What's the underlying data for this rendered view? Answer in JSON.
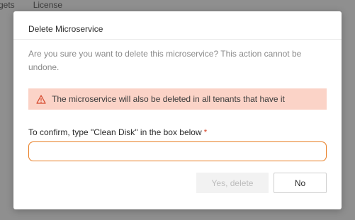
{
  "background": {
    "tabs": [
      "rgets",
      "License"
    ]
  },
  "dialog": {
    "title": "Delete Microservice",
    "message": "Are you sure you want to delete this microservice? This action cannot be undone.",
    "warning": {
      "icon": "warning-triangle-icon",
      "text": "The microservice will also be deleted in all tenants that have it"
    },
    "confirm_label": "To confirm, type \"Clean Disk\" in the box below",
    "required_marker": "*",
    "input_value": "",
    "yes_label": "Yes, delete",
    "no_label": "No"
  },
  "colors": {
    "accent": "#e87d22",
    "warning_bg": "#fbd3c7",
    "warning_icon": "#d64a2e",
    "required": "#d64a2e"
  }
}
